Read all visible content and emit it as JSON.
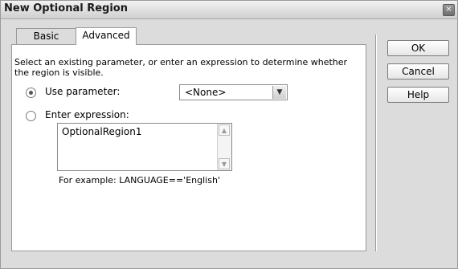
{
  "dialog": {
    "title": "New Optional Region",
    "close_glyph": "×"
  },
  "tabs": [
    {
      "label": "Basic",
      "active": false
    },
    {
      "label": "Advanced",
      "active": true
    }
  ],
  "advanced": {
    "description": "Select an existing parameter, or enter an expression to determine whether the region is visible.",
    "use_parameter": {
      "label": "Use parameter:",
      "checked": true,
      "selected_value": "<None>"
    },
    "enter_expression": {
      "label": "Enter expression:",
      "checked": false,
      "value": "OptionalRegion1"
    },
    "example": "For example: LANGUAGE=='English'"
  },
  "buttons": {
    "ok": "OK",
    "cancel": "Cancel",
    "help": "Help"
  },
  "icons": {
    "close": "close-icon",
    "dropdown": "chevron-down-icon",
    "scroll_up": "arrow-up-icon",
    "scroll_down": "arrow-down-icon"
  },
  "colors": {
    "window_bg": "#dcdcdc",
    "panel_bg": "#ffffff",
    "border": "#9a9a9a"
  }
}
